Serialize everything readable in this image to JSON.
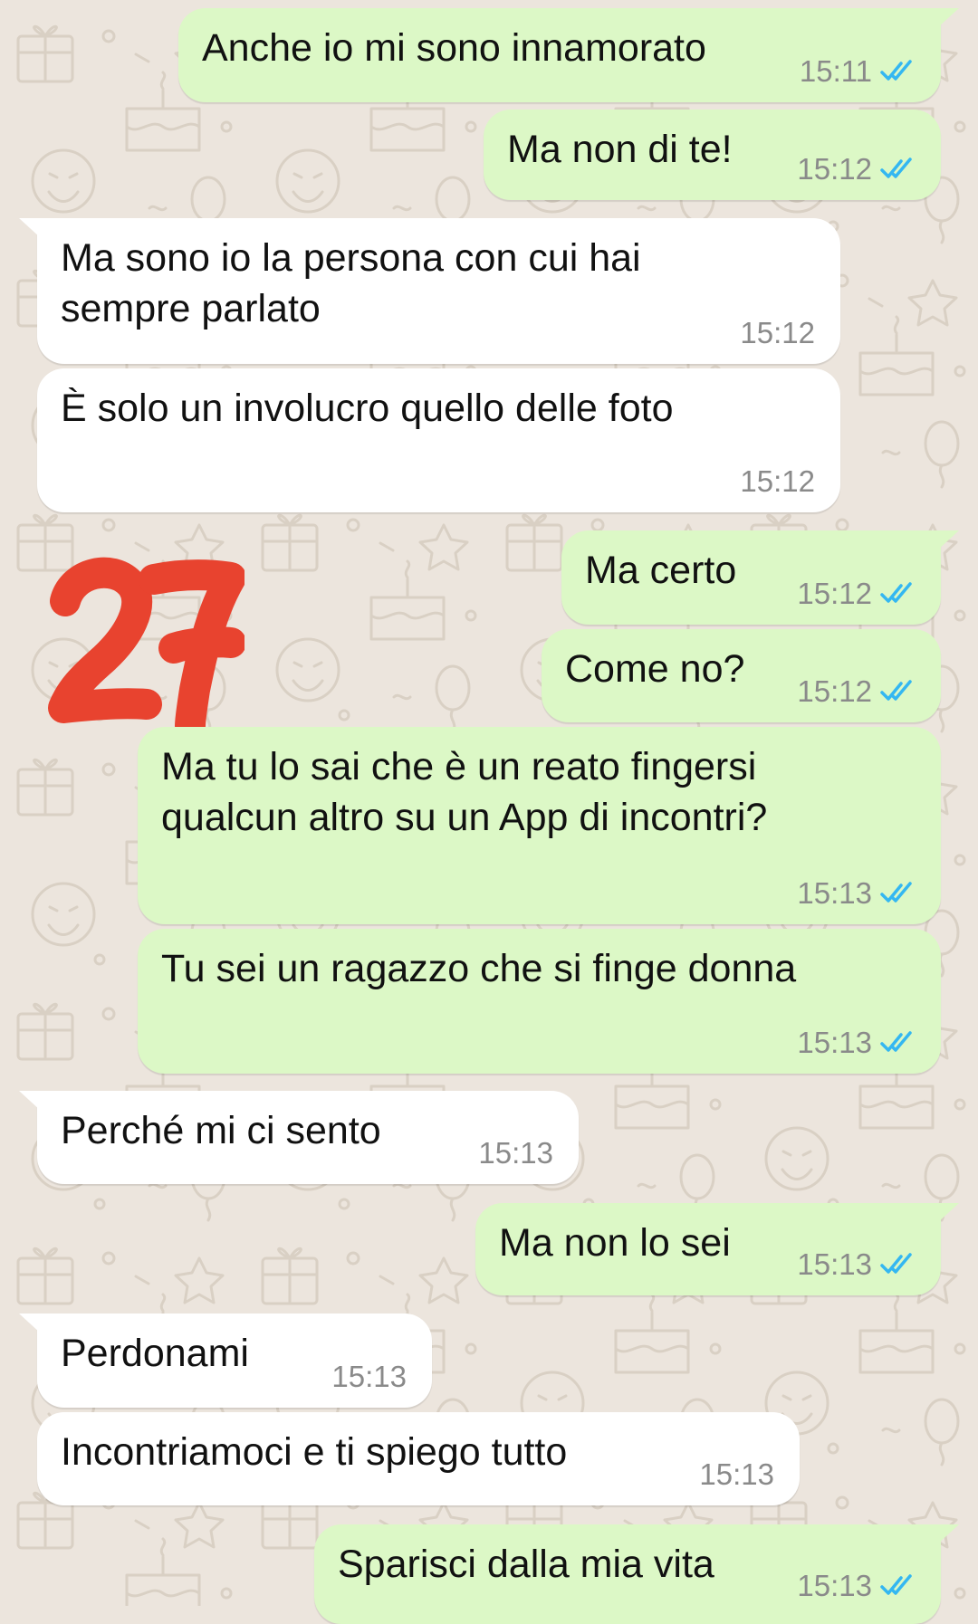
{
  "chat": {
    "accent_colors": {
      "outgoing_bubble": "#dcf8c6",
      "incoming_bubble": "#ffffff",
      "read_ticks": "#34b7f1",
      "wallpaper": "#ece5dd"
    },
    "overlay_number": "27",
    "messages": [
      {
        "direction": "out",
        "text": "Anche io mi sono innamorato",
        "time": "15:11",
        "status_icon": "double-check-read-icon"
      },
      {
        "direction": "out",
        "text": "Ma non di te!",
        "time": "15:12",
        "status_icon": "double-check-read-icon"
      },
      {
        "direction": "in",
        "text": "Ma sono io la persona con cui hai\nsempre parlato",
        "time": "15:12"
      },
      {
        "direction": "in",
        "text": "È solo un involucro quello delle foto",
        "time": "15:12"
      },
      {
        "direction": "out",
        "text": "Ma certo",
        "time": "15:12",
        "status_icon": "double-check-read-icon"
      },
      {
        "direction": "out",
        "text": "Come no?",
        "time": "15:12",
        "status_icon": "double-check-read-icon"
      },
      {
        "direction": "out",
        "text": "Ma tu lo sai che è un reato fingersi\nqualcun altro su un App di incontri?",
        "time": "15:13",
        "status_icon": "double-check-read-icon"
      },
      {
        "direction": "out",
        "text": "Tu sei un ragazzo che si finge donna",
        "time": "15:13",
        "status_icon": "double-check-read-icon"
      },
      {
        "direction": "in",
        "text": "Perché mi ci sento",
        "time": "15:13"
      },
      {
        "direction": "out",
        "text": "Ma non lo sei",
        "time": "15:13",
        "status_icon": "double-check-read-icon"
      },
      {
        "direction": "in",
        "text": "Perdonami",
        "time": "15:13"
      },
      {
        "direction": "in",
        "text": "Incontriamoci e ti spiego tutto",
        "time": "15:13"
      },
      {
        "direction": "out",
        "text": "Sparisci dalla mia vita",
        "time": "15:13",
        "status_icon": "double-check-read-icon"
      }
    ]
  }
}
